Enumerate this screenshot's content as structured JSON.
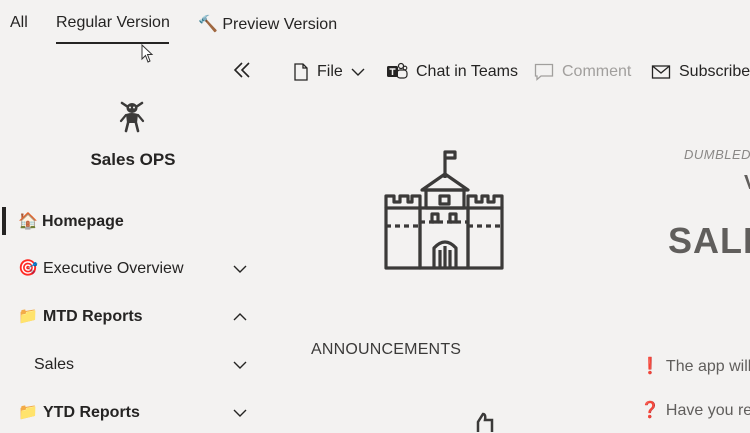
{
  "top_tabs": {
    "all": "All",
    "regular": "Regular Version",
    "preview": "Preview Version"
  },
  "commands": {
    "file": "File",
    "chat": "Chat in Teams",
    "comment": "Comment",
    "subscribe": "Subscribe"
  },
  "sidebar": {
    "site_title": "Sales OPS",
    "items": [
      {
        "emoji": "🏠",
        "label": "Homepage"
      },
      {
        "emoji": "🎯",
        "label": "Executive Overview"
      },
      {
        "emoji": "📁",
        "label": "MTD Reports"
      },
      {
        "emoji": "",
        "label": "Sales"
      },
      {
        "emoji": "📁",
        "label": "YTD Reports"
      }
    ]
  },
  "content": {
    "announcements": "ANNOUNCEMENTS",
    "dumble_text": "DUMBLED",
    "v_letter": "V",
    "sales_heading": "SALE",
    "note1": "The app will",
    "note2": "Have you reg",
    "note1_mark": "❗",
    "note2_mark": "❓"
  },
  "icons": {
    "preview_icon": "hammer-icon",
    "logo": "goblin-icon"
  }
}
